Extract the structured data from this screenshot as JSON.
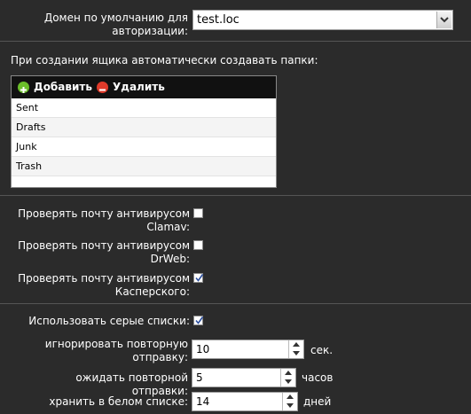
{
  "domain": {
    "label": "Домен по умолчанию для авторизации:",
    "value": "test.loc"
  },
  "folders": {
    "heading": "При создании ящика автоматически создавать папки:",
    "add_label": "Добавить",
    "delete_label": "Удалить",
    "items": [
      "Sent",
      "Drafts",
      "Junk",
      "Trash"
    ]
  },
  "antivirus": {
    "clamav_label": "Проверять почту антивирусом Clamav:",
    "clamav_checked": false,
    "drweb_label": "Проверять почту антивирусом DrWeb:",
    "drweb_checked": false,
    "kaspersky_label": "Проверять почту антивирусом Касперского:",
    "kaspersky_checked": true
  },
  "greylist": {
    "use_label": "Использовать серые списки:",
    "use_checked": true,
    "ignore_label": "игнорировать повторную отправку:",
    "ignore_value": "10",
    "ignore_unit": "сек.",
    "wait_label": "ожидать повторной отправки:",
    "wait_value": "5",
    "wait_unit": "часов",
    "keep_label": "хранить в белом списке:",
    "keep_value": "14",
    "keep_unit": "дней"
  },
  "colors": {
    "background": "#2b2b2b",
    "toolbar": "#111111",
    "add_icon": "#6bbf2a",
    "delete_icon": "#e03a2a"
  }
}
